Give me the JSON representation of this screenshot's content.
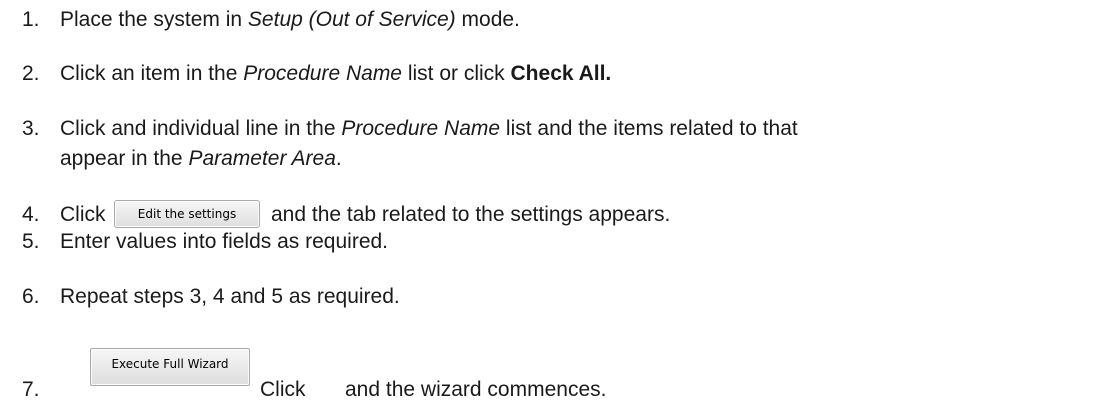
{
  "steps": [
    {
      "number": "1.",
      "parts": [
        {
          "t": "Place the system in "
        },
        {
          "t": "Setup (Out of Service)",
          "s": "em"
        },
        {
          "t": " mode."
        }
      ]
    },
    {
      "number": "2.",
      "parts": [
        {
          "t": "Click an item in the "
        },
        {
          "t": "Procedure Name",
          "s": "em"
        },
        {
          "t": " list or click "
        },
        {
          "t": "Check All.",
          "s": "strong"
        }
      ]
    },
    {
      "number": "3.",
      "parts": [
        {
          "t": "Click and individual line in the "
        },
        {
          "t": "Procedure Name",
          "s": "em"
        },
        {
          "t": " list and the items related to that"
        }
      ],
      "line2": [
        {
          "t": "appear in the "
        },
        {
          "t": "Parameter Area",
          "s": "em"
        },
        {
          "t": "."
        }
      ]
    },
    {
      "number": "4.",
      "before": "Click",
      "button": "Edit the settings",
      "after": "and the tab related to the settings appears."
    },
    {
      "number": "5.",
      "parts": [
        {
          "t": "Enter values into fields as required."
        }
      ]
    },
    {
      "number": "6.",
      "parts": [
        {
          "t": "Repeat steps 3, 4 and 5 as required."
        }
      ]
    },
    {
      "number": "7.",
      "button": "Execute Full Wizard",
      "click": "Click",
      "after": "and the wizard commences."
    }
  ]
}
